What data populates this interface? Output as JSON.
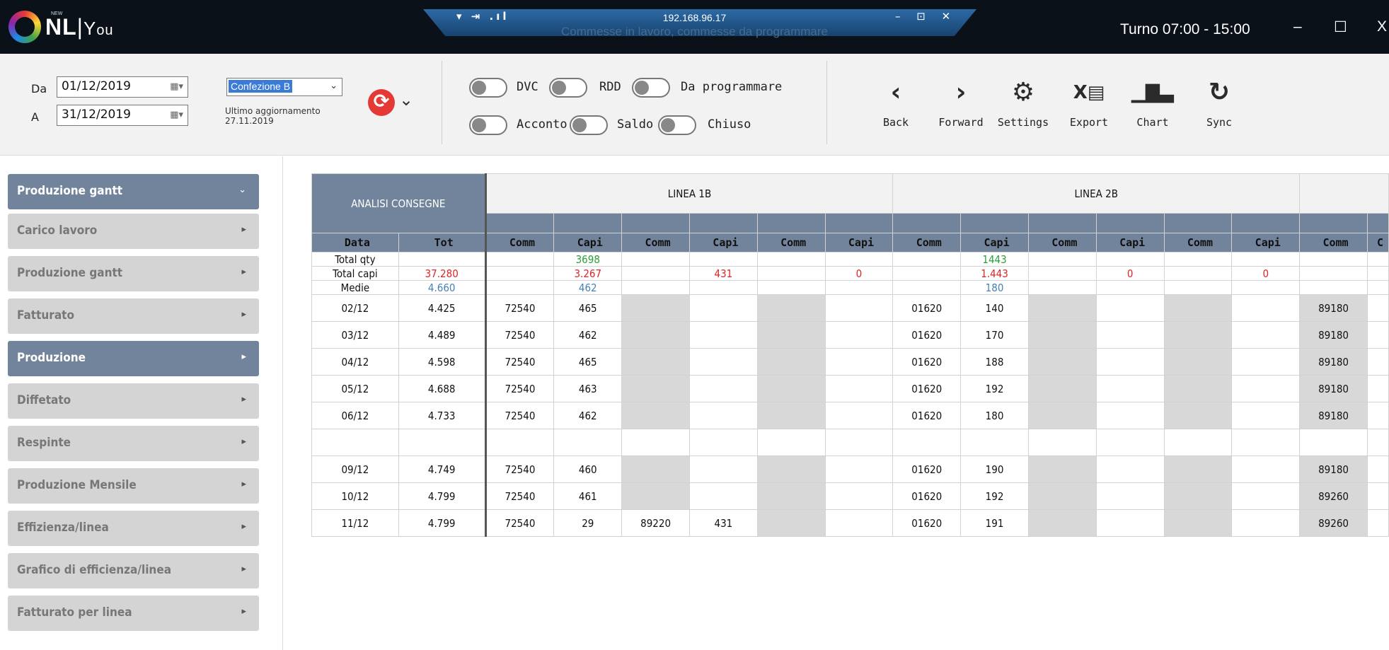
{
  "titlebar": {
    "logo_new": "NEW",
    "logo_name": "NL",
    "logo_you": "Y",
    "logo_ou": "ou",
    "remote_icons": "▾ ⇥ .ıl",
    "remote_ip": "192.168.96.17",
    "remote_subtitle": "Commesse in lavoro, commesse da programmare",
    "remote_window_buttons": "– ⊡ ✕",
    "shift": "Turno 07:00 - 15:00",
    "minimize": "–",
    "maximize": "☐",
    "close": "X"
  },
  "filters": {
    "from_label": "Da",
    "from_date": "01/12/2019",
    "to_label": "A",
    "to_date": "31/12/2019",
    "line_select": "Confezione B",
    "last_update_label": "Ultimo aggiornamento",
    "last_update_value": "27.11.2019"
  },
  "toggles": [
    {
      "label": "DVC"
    },
    {
      "label": "RDD"
    },
    {
      "label": "Da programmare"
    },
    {
      "label": "Acconto"
    },
    {
      "label": "Saldo"
    },
    {
      "label": "Chiuso"
    }
  ],
  "nav": [
    {
      "label": "Back",
      "icon": "‹"
    },
    {
      "label": "Forward",
      "icon": "›"
    },
    {
      "label": "Settings",
      "icon": "⚙"
    },
    {
      "label": "Export",
      "icon": "X▤"
    },
    {
      "label": "Chart",
      "icon": "▁▇▃"
    },
    {
      "label": "Sync",
      "icon": "↻"
    }
  ],
  "sidebar": {
    "items": [
      {
        "label": "Produzione gantt",
        "arrow": "⌄",
        "active": true
      },
      {
        "label": "Carico lavoro",
        "arrow": "▸",
        "active": false
      },
      {
        "label": "Produzione gantt",
        "arrow": "▸",
        "active": false
      },
      {
        "label": "Fatturato",
        "arrow": "▸",
        "active": false
      },
      {
        "label": "Produzione",
        "arrow": "▸",
        "active": true
      },
      {
        "label": "Diffetato",
        "arrow": "▸",
        "active": false
      },
      {
        "label": "Respinte",
        "arrow": "▸",
        "active": false
      },
      {
        "label": "Produzione Mensile",
        "arrow": "▸",
        "active": false
      },
      {
        "label": "Effizienza/linea",
        "arrow": "▸",
        "active": false
      },
      {
        "label": "Grafico di efficienza/linea",
        "arrow": "▸",
        "active": false
      },
      {
        "label": "Fatturato per linea",
        "arrow": "▸",
        "active": false
      }
    ]
  },
  "grid": {
    "group_analysis": "ANALISI CONSEGNE",
    "group_line1": "LINEA 1B",
    "group_line2": "LINEA 2B",
    "columns": [
      "Data",
      "Tot",
      "Comm",
      "Capi",
      "Comm",
      "Capi",
      "Comm",
      "Capi",
      "Comm",
      "Capi",
      "Comm",
      "Capi",
      "Comm",
      "Capi",
      "Comm",
      "C"
    ],
    "summary": [
      {
        "label": "Total qty",
        "tot": "",
        "l1_capi1": "3698",
        "l1_capi2": "",
        "l1_capi3": "",
        "l2_capi1": "1443",
        "l2_capi2": "",
        "l2_capi3": ""
      },
      {
        "label": "Total capi",
        "tot": "37.280",
        "l1_capi1": "3.267",
        "l1_capi2": "431",
        "l1_capi3": "0",
        "l2_capi1": "1.443",
        "l2_capi2": "0",
        "l2_capi3": "0"
      },
      {
        "label": "Medie",
        "tot": "4.660",
        "l1_capi1": "462",
        "l1_capi2": "",
        "l1_capi3": "",
        "l2_capi1": "180",
        "l2_capi2": "",
        "l2_capi3": ""
      }
    ],
    "rows": [
      {
        "date": "02/12",
        "tot": "4.425",
        "c1": "72540",
        "p1": "465",
        "c2": "",
        "p2": "",
        "c4": "01620",
        "p4": "140",
        "c7": "89180"
      },
      {
        "date": "03/12",
        "tot": "4.489",
        "c1": "72540",
        "p1": "462",
        "c2": "",
        "p2": "",
        "c4": "01620",
        "p4": "170",
        "c7": "89180"
      },
      {
        "date": "04/12",
        "tot": "4.598",
        "c1": "72540",
        "p1": "465",
        "c2": "",
        "p2": "",
        "c4": "01620",
        "p4": "188",
        "c7": "89180"
      },
      {
        "date": "05/12",
        "tot": "4.688",
        "c1": "72540",
        "p1": "463",
        "c2": "",
        "p2": "",
        "c4": "01620",
        "p4": "192",
        "c7": "89180"
      },
      {
        "date": "06/12",
        "tot": "4.733",
        "c1": "72540",
        "p1": "462",
        "c2": "",
        "p2": "",
        "c4": "01620",
        "p4": "180",
        "c7": "89180"
      },
      {
        "date": "",
        "tot": "",
        "c1": "",
        "p1": "",
        "c2": "",
        "p2": "",
        "c4": "",
        "p4": "",
        "c7": "",
        "blank": true
      },
      {
        "date": "09/12",
        "tot": "4.749",
        "c1": "72540",
        "p1": "460",
        "c2": "",
        "p2": "",
        "c4": "01620",
        "p4": "190",
        "c7": "89180"
      },
      {
        "date": "10/12",
        "tot": "4.799",
        "c1": "72540",
        "p1": "461",
        "c2": "",
        "p2": "",
        "c4": "01620",
        "p4": "192",
        "c7": "89260"
      },
      {
        "date": "11/12",
        "tot": "4.799",
        "c1": "72540",
        "p1": "29",
        "c2": "89220",
        "p2": "431",
        "c4": "01620",
        "p4": "191",
        "c7": "89260"
      }
    ]
  },
  "colors": {
    "header_slate": "#72849c",
    "green": "#2e9e3b",
    "red": "#e02424",
    "blue": "#4682b4",
    "sync_red": "#e53935"
  }
}
